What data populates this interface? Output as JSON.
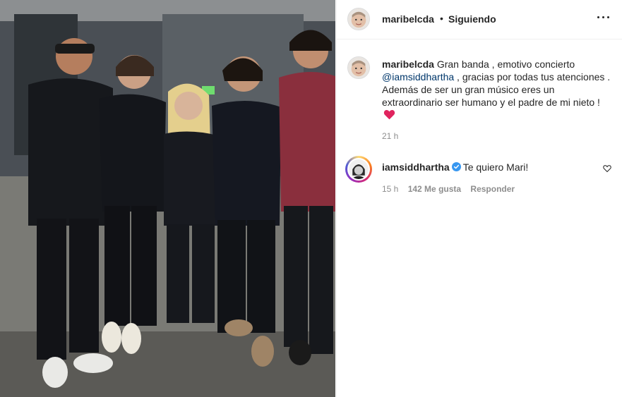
{
  "post": {
    "author": "maribelcda",
    "follow_status": "Siguiendo",
    "separator": "•"
  },
  "caption": {
    "username": "maribelcda",
    "text_before": "Gran banda , emotivo concierto",
    "mention": "@iamsiddhartha",
    "text_after": ", gracias por todas tus atenciones . Además de ser un gran músico eres un extraordinario ser humano y el padre de mi nieto !",
    "emoji": "red-heart",
    "time": "21 h"
  },
  "comments": [
    {
      "username": "iamsiddhartha",
      "verified": true,
      "text": "Te quiero Mari!",
      "time": "15 h",
      "likes": "142 Me gusta",
      "reply_label": "Responder"
    }
  ],
  "icons": {
    "more": "more-options-icon",
    "like": "heart-outline-icon",
    "verified": "verified-badge-icon"
  },
  "colors": {
    "mention": "#00376b",
    "verified": "#3897f0",
    "heart": "#e0245e",
    "muted": "#8e8e8e"
  }
}
